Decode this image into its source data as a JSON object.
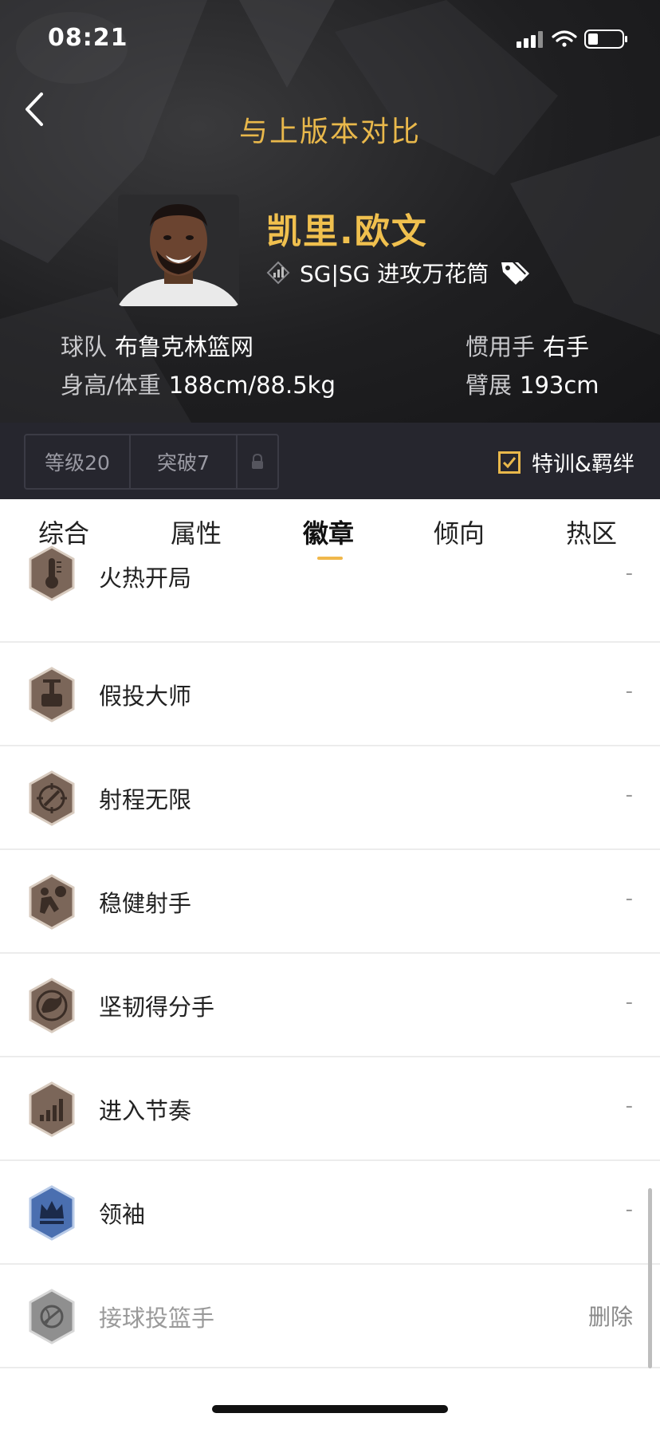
{
  "status_bar": {
    "time": "08:21"
  },
  "header": {
    "title": "与上版本对比"
  },
  "player": {
    "name": "凯里.欧文",
    "subtitle": "SG|SG 进攻万花筒",
    "team_label": "球队",
    "team_value": "布鲁克林篮网",
    "hand_label": "惯用手",
    "hand_value": "右手",
    "hw_label": "身高/体重",
    "hw_value": "188cm/88.5kg",
    "span_label": "臂展",
    "span_value": "193cm"
  },
  "level": {
    "grade": "等级20",
    "breakthrough": "突破7",
    "lock_icon": "lock-icon"
  },
  "training": {
    "label": "特训&羁绊",
    "checked": true
  },
  "tabs": [
    {
      "label": "综合"
    },
    {
      "label": "属性"
    },
    {
      "label": "徽章",
      "active": true
    },
    {
      "label": "倾向"
    },
    {
      "label": "热区"
    }
  ],
  "badges": [
    {
      "name": "火热开局",
      "value": "-",
      "icon": "thermometer-icon",
      "tier": "bronze"
    },
    {
      "name": "假投大师",
      "value": "-",
      "icon": "pump-fake-icon",
      "tier": "bronze"
    },
    {
      "name": "射程无限",
      "value": "-",
      "icon": "crosshair-icon",
      "tier": "bronze"
    },
    {
      "name": "稳健射手",
      "value": "-",
      "icon": "shooter-icon",
      "tier": "bronze"
    },
    {
      "name": "坚韧得分手",
      "value": "-",
      "icon": "muscle-icon",
      "tier": "bronze"
    },
    {
      "name": "进入节奏",
      "value": "-",
      "icon": "signal-bars-icon",
      "tier": "bronze"
    },
    {
      "name": "领袖",
      "value": "-",
      "icon": "crown-icon",
      "tier": "blue"
    },
    {
      "name": "接球投篮手",
      "action": "删除",
      "icon": "catch-shoot-icon",
      "tier": "gray"
    }
  ],
  "colors": {
    "accent": "#f0c04e",
    "bronze": "#7b6659",
    "blue": "#4a6fb0"
  }
}
